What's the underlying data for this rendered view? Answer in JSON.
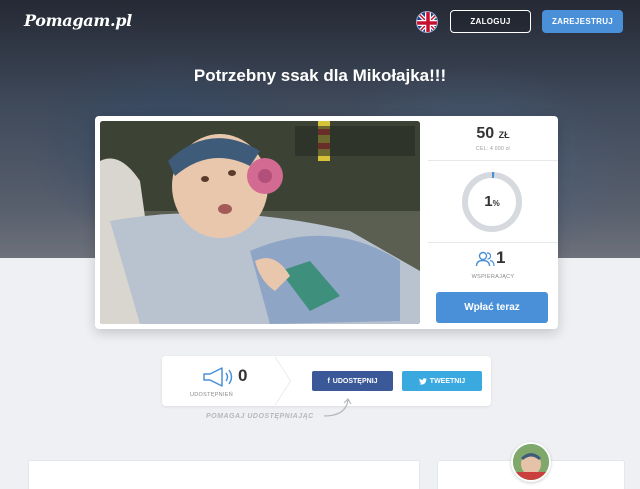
{
  "header": {
    "logo": "Pomagam.pl",
    "login_label": "ZALOGUJ",
    "register_label": "ZAREJESTRUJ",
    "language_icon": "uk-flag-icon"
  },
  "campaign": {
    "title": "Potrzebny ssak dla Mikołajka!!!",
    "amount_value": "50",
    "amount_currency": "ZŁ",
    "goal_text": "CEL: 4 000 zł",
    "progress_value": "1",
    "progress_unit": "%",
    "progress_fraction": 0.0125,
    "supporters_count": "1",
    "supporters_label": "WSPIERAJĄCY",
    "donate_label": "Wpłać teraz"
  },
  "share": {
    "count": "0",
    "count_label": "UDOSTĘPNIEŃ",
    "facebook_label": "UDOSTĘPNIJ",
    "twitter_label": "TWEETNIJ",
    "hint": "POMAGAJ UDOSTĘPNIAJĄC"
  },
  "colors": {
    "accent": "#4a90d9",
    "facebook": "#3b5998",
    "twitter": "#39a9e0"
  }
}
